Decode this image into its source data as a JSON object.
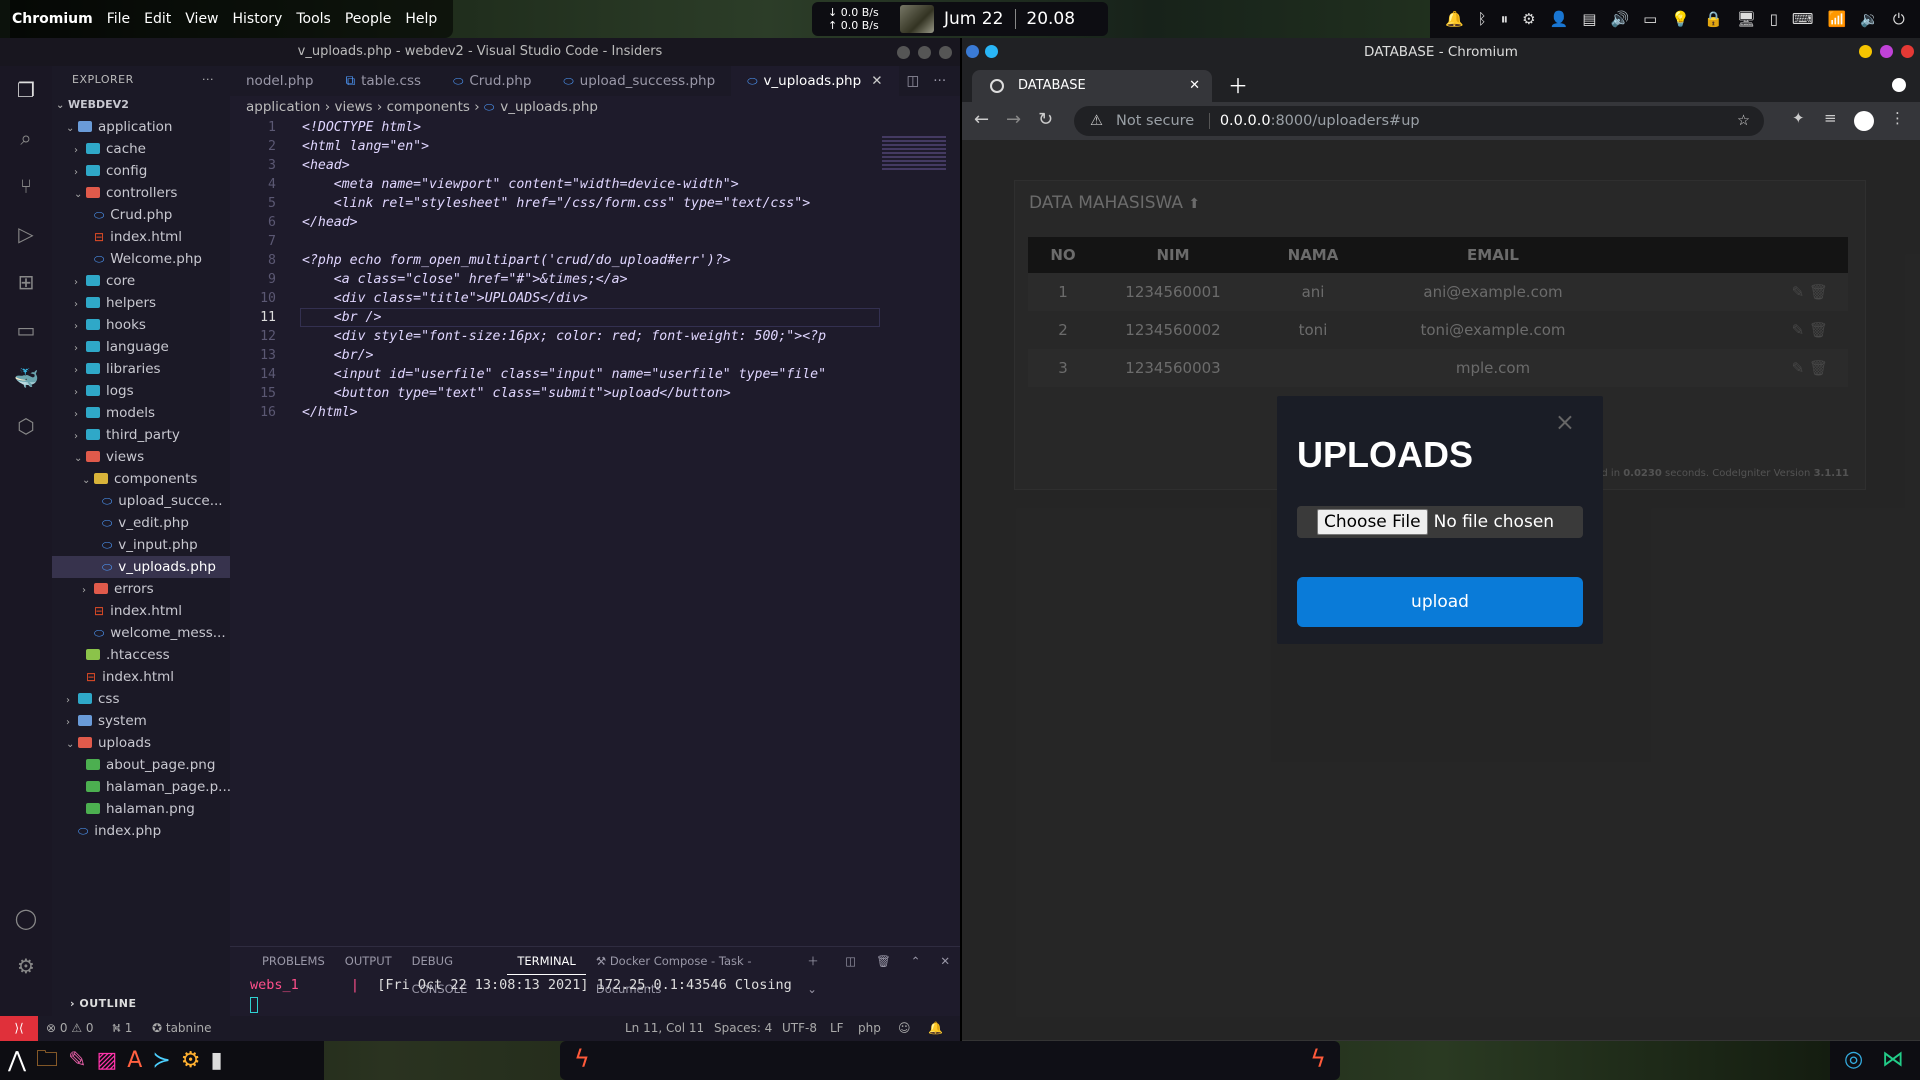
{
  "topbar": {
    "menu": [
      "Chromium",
      "File",
      "Edit",
      "View",
      "History",
      "Tools",
      "People",
      "Help"
    ],
    "net_down": "0.0 B/s",
    "net_up": "0.0 B/s",
    "date": "Jum   22",
    "time": "20.08"
  },
  "vscode": {
    "window_title": "v_uploads.php - webdev2 - Visual Studio Code - Insiders",
    "explorer_label": "EXPLORER",
    "root": "WEBDEV2",
    "tree": [
      {
        "label": "application",
        "depth": 1,
        "type": "folder-open"
      },
      {
        "label": "cache",
        "depth": 2,
        "type": "folder"
      },
      {
        "label": "config",
        "depth": 2,
        "type": "folder"
      },
      {
        "label": "controllers",
        "depth": 2,
        "type": "folder-open"
      },
      {
        "label": "Crud.php",
        "depth": 3,
        "type": "php"
      },
      {
        "label": "index.html",
        "depth": 3,
        "type": "html"
      },
      {
        "label": "Welcome.php",
        "depth": 3,
        "type": "php"
      },
      {
        "label": "core",
        "depth": 2,
        "type": "folder"
      },
      {
        "label": "helpers",
        "depth": 2,
        "type": "folder"
      },
      {
        "label": "hooks",
        "depth": 2,
        "type": "folder"
      },
      {
        "label": "language",
        "depth": 2,
        "type": "folder"
      },
      {
        "label": "libraries",
        "depth": 2,
        "type": "folder"
      },
      {
        "label": "logs",
        "depth": 2,
        "type": "folder"
      },
      {
        "label": "models",
        "depth": 2,
        "type": "folder"
      },
      {
        "label": "third_party",
        "depth": 2,
        "type": "folder"
      },
      {
        "label": "views",
        "depth": 2,
        "type": "folder-open"
      },
      {
        "label": "components",
        "depth": 3,
        "type": "folder-open"
      },
      {
        "label": "upload_succe...",
        "depth": 4,
        "type": "php"
      },
      {
        "label": "v_edit.php",
        "depth": 4,
        "type": "php"
      },
      {
        "label": "v_input.php",
        "depth": 4,
        "type": "php"
      },
      {
        "label": "v_uploads.php",
        "depth": 4,
        "type": "php",
        "selected": true
      },
      {
        "label": "errors",
        "depth": 3,
        "type": "folder"
      },
      {
        "label": "index.html",
        "depth": 3,
        "type": "html"
      },
      {
        "label": "welcome_mess...",
        "depth": 3,
        "type": "php"
      },
      {
        "label": ".htaccess",
        "depth": 2,
        "type": "file"
      },
      {
        "label": "index.html",
        "depth": 2,
        "type": "html"
      },
      {
        "label": "css",
        "depth": 1,
        "type": "folder"
      },
      {
        "label": "system",
        "depth": 1,
        "type": "folder"
      },
      {
        "label": "uploads",
        "depth": 1,
        "type": "folder-open"
      },
      {
        "label": "about_page.png",
        "depth": 2,
        "type": "img"
      },
      {
        "label": "halaman_page.p...",
        "depth": 2,
        "type": "img"
      },
      {
        "label": "halaman.png",
        "depth": 2,
        "type": "img"
      },
      {
        "label": "index.php",
        "depth": 1,
        "type": "php"
      }
    ],
    "outline_label": "OUTLINE",
    "tabs": [
      {
        "label": "nodel.php"
      },
      {
        "label": "table.css"
      },
      {
        "label": "Crud.php"
      },
      {
        "label": "upload_success.php"
      },
      {
        "label": "v_uploads.php",
        "active": true
      }
    ],
    "breadcrumb": [
      "application",
      "views",
      "components",
      "v_uploads.php"
    ],
    "code_lines": [
      "<!DOCTYPE html>",
      "<html lang=\"en\">",
      "<head>",
      "    <meta name=\"viewport\" content=\"width=device-width\">",
      "    <link rel=\"stylesheet\" href=\"/css/form.css\" type=\"text/css\">",
      "</head>",
      "",
      "<?php echo form_open_multipart('crud/do_upload#err')?>",
      "    <a class=\"close\" href=\"#\">&times;</a>",
      "    <div class=\"title\">UPLOADS</div>",
      "    <br />",
      "    <div style=\"font-size:16px; color: red; font-weight: 500;\"><?p",
      "    <br/>",
      "    <input id=\"userfile\" class=\"input\" name=\"userfile\" type=\"file\"",
      "    <button type=\"text\" class=\"submit\">upload</button>",
      "</html>"
    ],
    "current_line": 11,
    "panel_tabs": [
      "PROBLEMS",
      "OUTPUT",
      "DEBUG CONSOLE",
      "TERMINAL",
      "Docker Compose - Task - Documents"
    ],
    "terminal_prefix": "webs_1",
    "terminal_line": "[Fri Oct 22 13:08:13 2021] 172.25.0.1:43546 Closing",
    "status": {
      "errors": "0",
      "warnings": "0",
      "ports": "1",
      "tabnine": "tabnine",
      "position": "Ln 11, Col 11",
      "spaces": "Spaces: 4",
      "encoding": "UTF-8",
      "eol": "LF",
      "lang": "php"
    }
  },
  "chromium": {
    "window_title": "DATABASE - Chromium",
    "tab_label": "DATABASE",
    "not_secure": "Not secure",
    "url_host": "0.0.0.0",
    "url_rest": ":8000/uploaders#up",
    "page": {
      "heading": "DATA MAHASISWA",
      "columns": [
        "NO",
        "NIM",
        "NAMA",
        "EMAIL"
      ],
      "rows": [
        {
          "no": "1",
          "nim": "1234560001",
          "nama": "ani",
          "email": "ani@example.com"
        },
        {
          "no": "2",
          "nim": "1234560002",
          "nama": "toni",
          "email": "toni@example.com"
        },
        {
          "no": "3",
          "nim": "1234560003",
          "nama": "",
          "email": "mple.com"
        }
      ],
      "footer_prefix": "d in ",
      "footer_time": "0.0230",
      "footer_mid": " seconds. CodeIgniter Version ",
      "footer_version": "3.1.11"
    },
    "modal": {
      "close": "×",
      "title": "UPLOADS",
      "choose_file": "Choose File",
      "no_file": "No file chosen",
      "upload_label": "upload"
    }
  }
}
